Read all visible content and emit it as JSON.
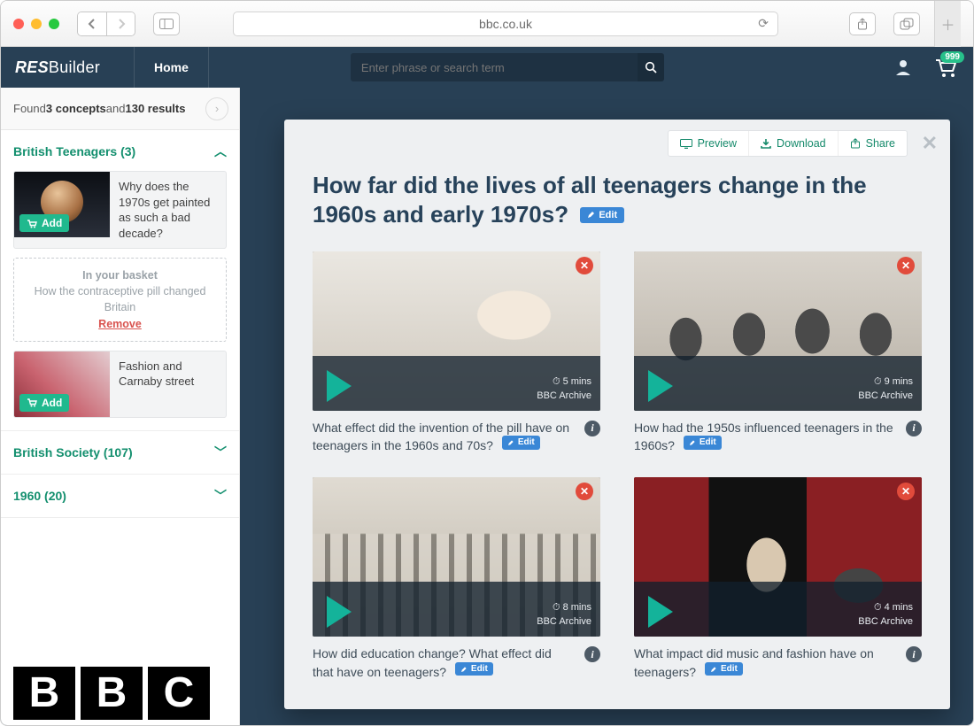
{
  "browser": {
    "url": "bbc.co.uk"
  },
  "app": {
    "brand_prefix": "RES",
    "brand_suffix": "Builder",
    "home": "Home",
    "search_placeholder": "Enter phrase or search term",
    "cart_badge": "999"
  },
  "found": {
    "prefix": "Found ",
    "concepts": "3 concepts",
    "mid": " and ",
    "results": "130 results"
  },
  "concepts": [
    {
      "title": "British Teenagers (3)",
      "expanded": true,
      "items": [
        {
          "kind": "card",
          "text": "Why does the 1970s get painted as such a bad decade?",
          "add": "Add",
          "thumb": "decade"
        },
        {
          "kind": "basket",
          "heading": "In your basket",
          "text": "How the contraceptive pill changed Britain",
          "remove": "Remove"
        },
        {
          "kind": "card",
          "text": "Fashion and Carnaby street",
          "add": "Add",
          "thumb": "fashion"
        }
      ]
    },
    {
      "title": "British Society (107)",
      "expanded": false
    },
    {
      "title": "1960 (20)",
      "expanded": false
    }
  ],
  "panel": {
    "tools": {
      "preview": "Preview",
      "download": "Download",
      "share": "Share"
    },
    "title": "How far did the lives of all teenagers change in the 1960s and early 1970s?",
    "edit": "Edit",
    "clips": [
      {
        "question": "What effect did the invention of the pill have on teenagers in the 1960s and 70s?",
        "duration": "5 mins",
        "source": "BBC Archive",
        "ph": "pill"
      },
      {
        "question": "How had the 1950s influenced teenagers in the 1960s?",
        "duration": "9 mins",
        "source": "BBC Archive",
        "ph": "fifties"
      },
      {
        "question": "How did education change? What effect did that have on teenagers?",
        "duration": "8 mins",
        "source": "BBC Archive",
        "ph": "school"
      },
      {
        "question": "What impact did music and fashion have on teenagers?",
        "duration": "4 mins",
        "source": "BBC Archive",
        "ph": "music"
      }
    ]
  }
}
